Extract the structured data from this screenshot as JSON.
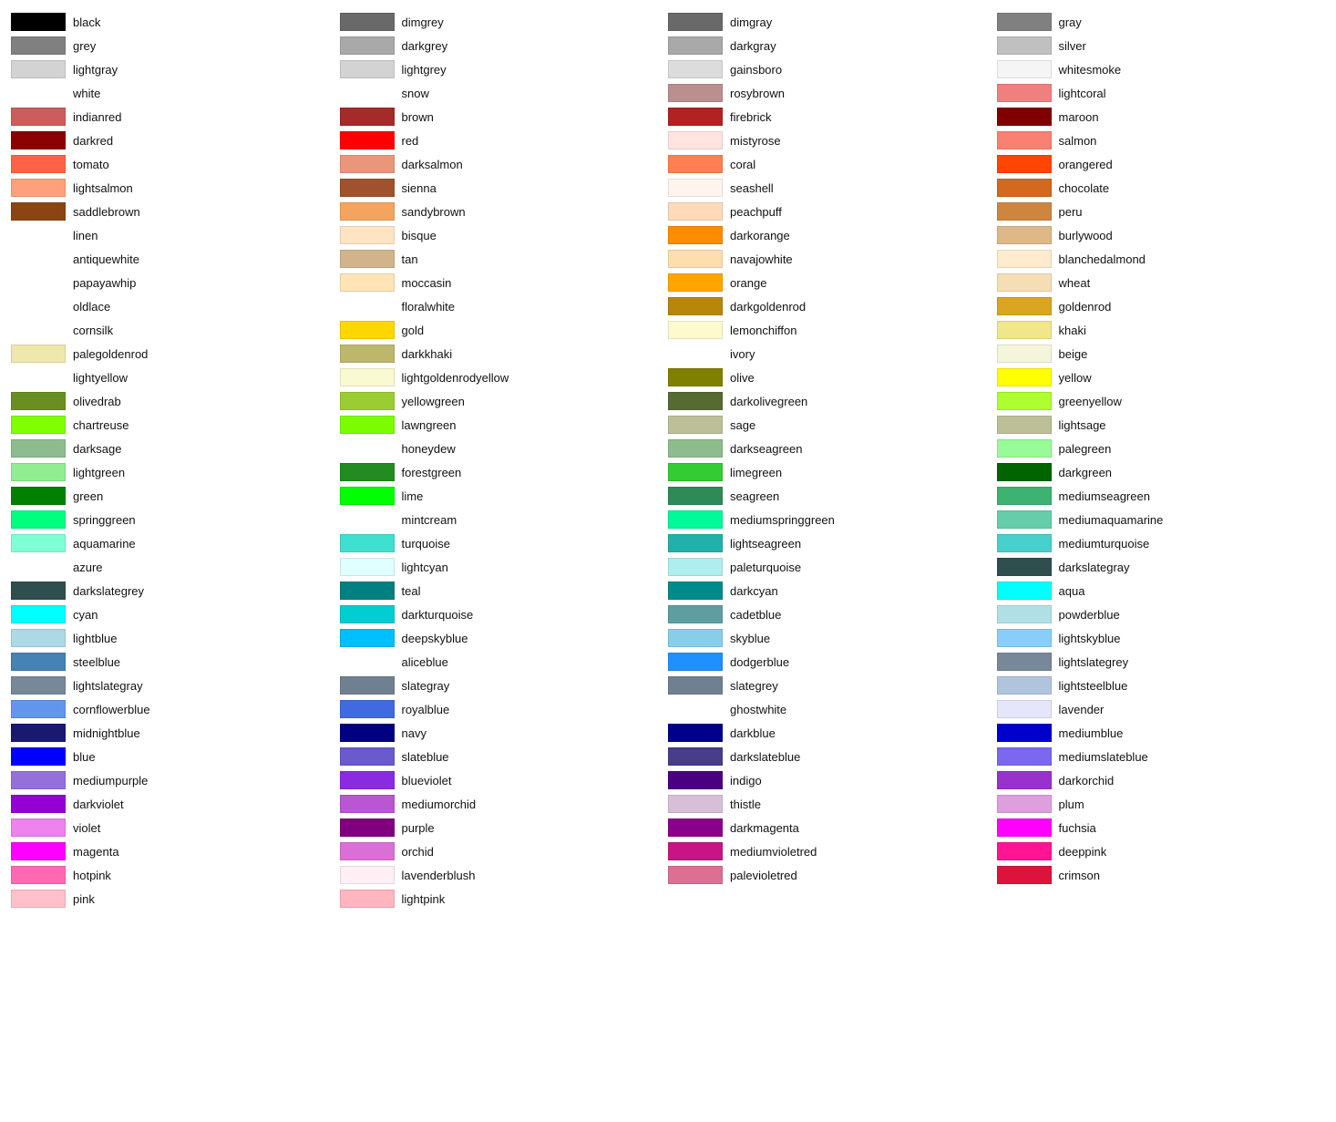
{
  "columns": [
    [
      {
        "name": "black",
        "color": "#000000"
      },
      {
        "name": "grey",
        "color": "#808080"
      },
      {
        "name": "lightgray",
        "color": "#d3d3d3"
      },
      {
        "name": "white",
        "color": null
      },
      {
        "name": "indianred",
        "color": "#cd5c5c"
      },
      {
        "name": "darkred",
        "color": "#8b0000"
      },
      {
        "name": "tomato",
        "color": "#ff6347"
      },
      {
        "name": "lightsalmon",
        "color": "#ffa07a"
      },
      {
        "name": "saddlebrown",
        "color": "#8b4513"
      },
      {
        "name": "linen",
        "color": null
      },
      {
        "name": "antiquewhite",
        "color": null
      },
      {
        "name": "papayawhip",
        "color": null
      },
      {
        "name": "oldlace",
        "color": null
      },
      {
        "name": "cornsilk",
        "color": null
      },
      {
        "name": "palegoldenrod",
        "color": "#eee8aa"
      },
      {
        "name": "lightyellow",
        "color": null
      },
      {
        "name": "olivedrab",
        "color": "#6b8e23"
      },
      {
        "name": "chartreuse",
        "color": "#7fff00"
      },
      {
        "name": "darksage",
        "color": "#8fbc8f"
      },
      {
        "name": "lightgreen",
        "color": "#90ee90"
      },
      {
        "name": "green",
        "color": "#008000"
      },
      {
        "name": "springgreen",
        "color": "#00ff7f"
      },
      {
        "name": "aquamarine",
        "color": "#7fffd4"
      },
      {
        "name": "azure",
        "color": null
      },
      {
        "name": "darkslategrey",
        "color": "#2f4f4f"
      },
      {
        "name": "cyan",
        "color": "#00ffff"
      },
      {
        "name": "lightblue",
        "color": "#add8e6"
      },
      {
        "name": "steelblue",
        "color": "#4682b4"
      },
      {
        "name": "lightslategray",
        "color": "#778899"
      },
      {
        "name": "cornflowerblue",
        "color": "#6495ed"
      },
      {
        "name": "midnightblue",
        "color": "#191970"
      },
      {
        "name": "blue",
        "color": "#0000ff"
      },
      {
        "name": "mediumpurple",
        "color": "#9370db"
      },
      {
        "name": "darkviolet",
        "color": "#9400d3"
      },
      {
        "name": "violet",
        "color": "#ee82ee"
      },
      {
        "name": "magenta",
        "color": "#ff00ff"
      },
      {
        "name": "hotpink",
        "color": "#ff69b4"
      },
      {
        "name": "pink",
        "color": "#ffc0cb"
      }
    ],
    [
      {
        "name": "dimgrey",
        "color": "#696969"
      },
      {
        "name": "darkgrey",
        "color": "#a9a9a9"
      },
      {
        "name": "lightgrey",
        "color": "#d3d3d3"
      },
      {
        "name": "snow",
        "color": null
      },
      {
        "name": "brown",
        "color": "#a52a2a"
      },
      {
        "name": "red",
        "color": "#ff0000"
      },
      {
        "name": "darksalmon",
        "color": "#e9967a"
      },
      {
        "name": "sienna",
        "color": "#a0522d"
      },
      {
        "name": "sandybrown",
        "color": "#f4a460"
      },
      {
        "name": "bisque",
        "color": "#ffe4c4"
      },
      {
        "name": "tan",
        "color": "#d2b48c"
      },
      {
        "name": "moccasin",
        "color": "#ffe4b5"
      },
      {
        "name": "floralwhite",
        "color": null
      },
      {
        "name": "gold",
        "color": "#ffd700"
      },
      {
        "name": "darkkhaki",
        "color": "#bdb76b"
      },
      {
        "name": "lightgoldenrodyellow",
        "color": "#fafad2"
      },
      {
        "name": "yellowgreen",
        "color": "#9acd32"
      },
      {
        "name": "lawngreen",
        "color": "#7cfc00"
      },
      {
        "name": "honeydew",
        "color": null
      },
      {
        "name": "forestgreen",
        "color": "#228b22"
      },
      {
        "name": "lime",
        "color": "#00ff00"
      },
      {
        "name": "mintcream",
        "color": null
      },
      {
        "name": "turquoise",
        "color": "#40e0d0"
      },
      {
        "name": "lightcyan",
        "color": "#e0ffff"
      },
      {
        "name": "teal",
        "color": "#008080"
      },
      {
        "name": "darkturquoise",
        "color": "#00ced1"
      },
      {
        "name": "deepskyblue",
        "color": "#00bfff"
      },
      {
        "name": "aliceblue",
        "color": null
      },
      {
        "name": "slategray",
        "color": "#708090"
      },
      {
        "name": "royalblue",
        "color": "#4169e1"
      },
      {
        "name": "navy",
        "color": "#000080"
      },
      {
        "name": "slateblue",
        "color": "#6a5acd"
      },
      {
        "name": "blueviolet",
        "color": "#8a2be2"
      },
      {
        "name": "mediumorchid",
        "color": "#ba55d3"
      },
      {
        "name": "purple",
        "color": "#800080"
      },
      {
        "name": "orchid",
        "color": "#da70d6"
      },
      {
        "name": "lavenderblush",
        "color": "#fff0f5"
      },
      {
        "name": "lightpink",
        "color": "#ffb6c1"
      }
    ],
    [
      {
        "name": "dimgray",
        "color": "#696969"
      },
      {
        "name": "darkgray",
        "color": "#a9a9a9"
      },
      {
        "name": "gainsboro",
        "color": "#dcdcdc"
      },
      {
        "name": "rosybrown",
        "color": "#bc8f8f"
      },
      {
        "name": "firebrick",
        "color": "#b22222"
      },
      {
        "name": "mistyrose",
        "color": "#ffe4e1"
      },
      {
        "name": "coral",
        "color": "#ff7f50"
      },
      {
        "name": "seashell",
        "color": "#fff5ee"
      },
      {
        "name": "peachpuff",
        "color": "#ffdab9"
      },
      {
        "name": "darkorange",
        "color": "#ff8c00"
      },
      {
        "name": "navajowhite",
        "color": "#ffdead"
      },
      {
        "name": "orange",
        "color": "#ffa500"
      },
      {
        "name": "darkgoldenrod",
        "color": "#b8860b"
      },
      {
        "name": "lemonchiffon",
        "color": "#fffacd"
      },
      {
        "name": "ivory",
        "color": null
      },
      {
        "name": "olive",
        "color": "#808000"
      },
      {
        "name": "darkolivegreen",
        "color": "#556b2f"
      },
      {
        "name": "sage",
        "color": "#bcbf98"
      },
      {
        "name": "darkseagreen",
        "color": "#8fbc8f"
      },
      {
        "name": "limegreen",
        "color": "#32cd32"
      },
      {
        "name": "seagreen",
        "color": "#2e8b57"
      },
      {
        "name": "mediumspringgreen",
        "color": "#00fa9a"
      },
      {
        "name": "lightseagreen",
        "color": "#20b2aa"
      },
      {
        "name": "paleturquoise",
        "color": "#afeeee"
      },
      {
        "name": "darkcyan",
        "color": "#008b8b"
      },
      {
        "name": "cadetblue",
        "color": "#5f9ea0"
      },
      {
        "name": "skyblue",
        "color": "#87ceeb"
      },
      {
        "name": "dodgerblue",
        "color": "#1e90ff"
      },
      {
        "name": "slategrey",
        "color": "#708090"
      },
      {
        "name": "ghostwhite",
        "color": null
      },
      {
        "name": "darkblue",
        "color": "#00008b"
      },
      {
        "name": "darkslateblue",
        "color": "#483d8b"
      },
      {
        "name": "indigo",
        "color": "#4b0082"
      },
      {
        "name": "thistle",
        "color": "#d8bfd8"
      },
      {
        "name": "darkmagenta",
        "color": "#8b008b"
      },
      {
        "name": "mediumvioletred",
        "color": "#c71585"
      },
      {
        "name": "palevioletred",
        "color": "#db7093"
      }
    ],
    [
      {
        "name": "gray",
        "color": "#808080"
      },
      {
        "name": "silver",
        "color": "#c0c0c0"
      },
      {
        "name": "whitesmoke",
        "color": "#f5f5f5"
      },
      {
        "name": "lightcoral",
        "color": "#f08080"
      },
      {
        "name": "maroon",
        "color": "#800000"
      },
      {
        "name": "salmon",
        "color": "#fa8072"
      },
      {
        "name": "orangered",
        "color": "#ff4500"
      },
      {
        "name": "chocolate",
        "color": "#d2691e"
      },
      {
        "name": "peru",
        "color": "#cd853f"
      },
      {
        "name": "burlywood",
        "color": "#deb887"
      },
      {
        "name": "blanchedalmond",
        "color": "#ffebcd"
      },
      {
        "name": "wheat",
        "color": "#f5deb3"
      },
      {
        "name": "goldenrod",
        "color": "#daa520"
      },
      {
        "name": "khaki",
        "color": "#f0e68c"
      },
      {
        "name": "beige",
        "color": "#f5f5dc"
      },
      {
        "name": "yellow",
        "color": "#ffff00"
      },
      {
        "name": "greenyellow",
        "color": "#adff2f"
      },
      {
        "name": "lightsage",
        "color": "#bcbf98"
      },
      {
        "name": "palegreen",
        "color": "#98fb98"
      },
      {
        "name": "darkgreen",
        "color": "#006400"
      },
      {
        "name": "mediumseagreen",
        "color": "#3cb371"
      },
      {
        "name": "mediumaquamarine",
        "color": "#66cdaa"
      },
      {
        "name": "mediumturquoise",
        "color": "#48d1cc"
      },
      {
        "name": "darkslategray",
        "color": "#2f4f4f"
      },
      {
        "name": "aqua",
        "color": "#00ffff"
      },
      {
        "name": "powderblue",
        "color": "#b0e0e6"
      },
      {
        "name": "lightskyblue",
        "color": "#87cefa"
      },
      {
        "name": "lightslategrey",
        "color": "#778899"
      },
      {
        "name": "lightsteelblue",
        "color": "#b0c4de"
      },
      {
        "name": "lavender",
        "color": "#e6e6fa"
      },
      {
        "name": "mediumblue",
        "color": "#0000cd"
      },
      {
        "name": "mediumslateblue",
        "color": "#7b68ee"
      },
      {
        "name": "darkorchid",
        "color": "#9932cc"
      },
      {
        "name": "plum",
        "color": "#dda0dd"
      },
      {
        "name": "fuchsia",
        "color": "#ff00ff"
      },
      {
        "name": "deeppink",
        "color": "#ff1493"
      },
      {
        "name": "crimson",
        "color": "#dc143c"
      }
    ]
  ]
}
